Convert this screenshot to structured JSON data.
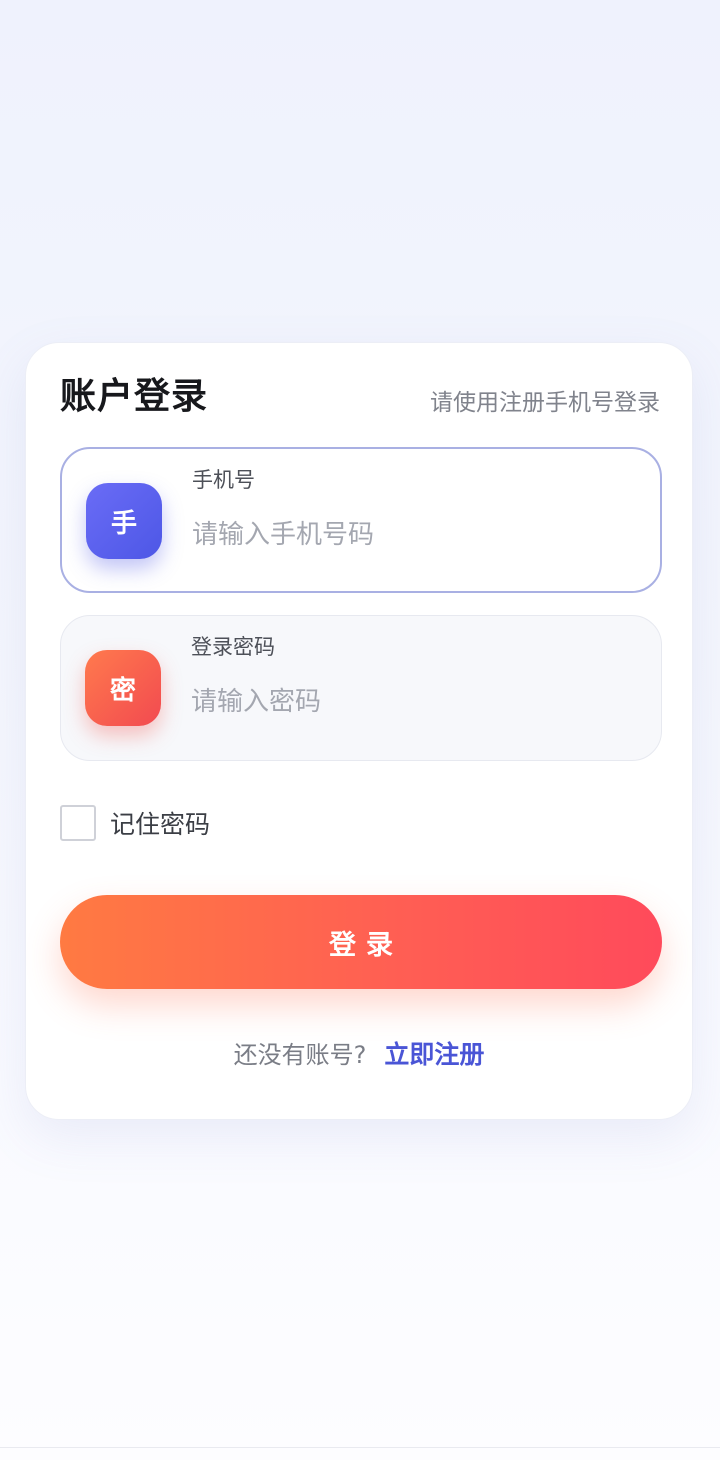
{
  "login_card": {
    "title": "账户登录",
    "subtitle": "请使用注册手机号登录"
  },
  "phone_field": {
    "badge": "手",
    "label": "手机号",
    "placeholder": "请输入手机号码",
    "value": ""
  },
  "password_field": {
    "badge": "密",
    "label": "登录密码",
    "placeholder": "请输入密码",
    "value": ""
  },
  "remember": {
    "label": "记住密码",
    "checked": false
  },
  "login_button": {
    "label": "登录"
  },
  "register": {
    "prompt": "还没有账号?",
    "link": "立即注册"
  },
  "colors": {
    "accent": "#4a55d6",
    "button_gradient_start": "#ff7a42",
    "button_gradient_end": "#ff4a5b",
    "phone_badge": "#5b62ef",
    "password_badge": "#f6614f"
  }
}
